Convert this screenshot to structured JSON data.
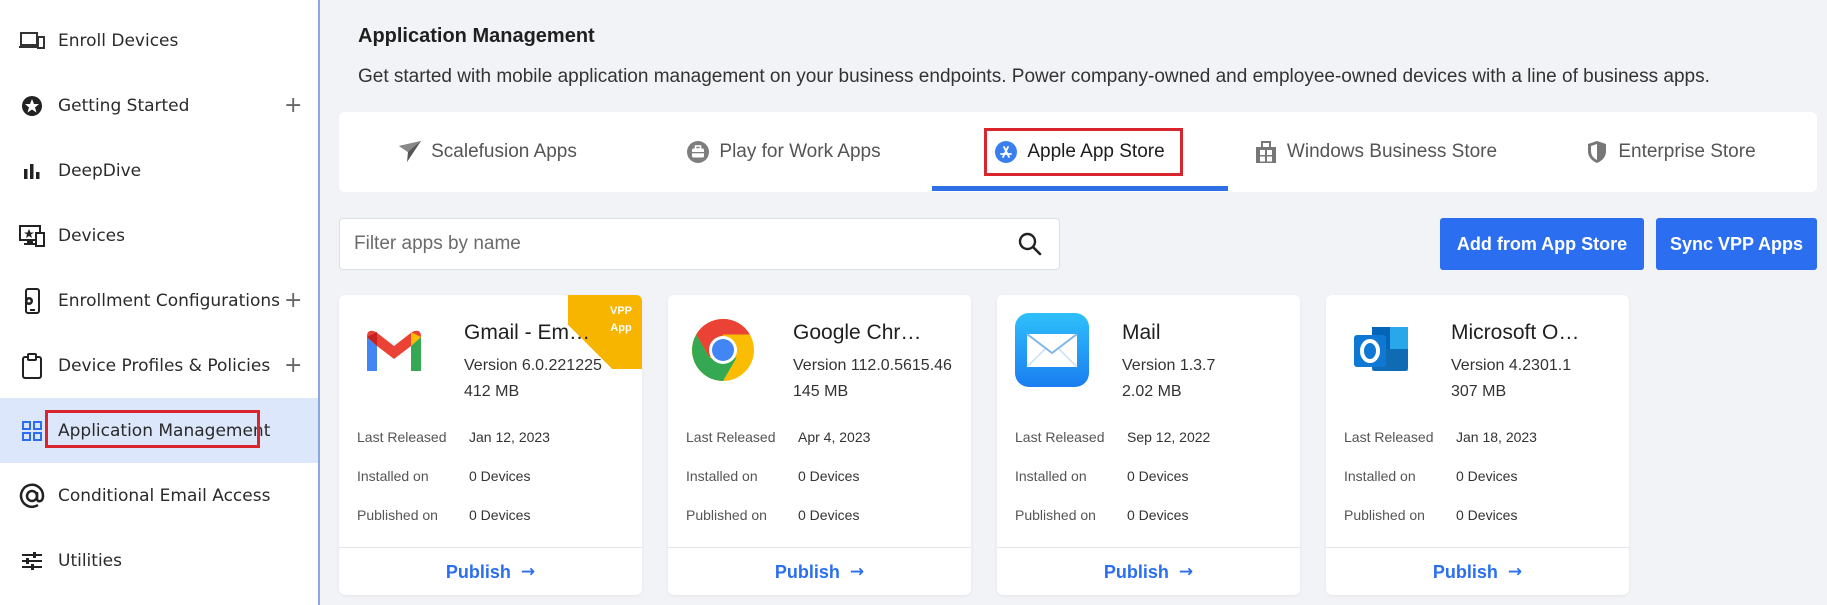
{
  "sidebar": {
    "items": [
      {
        "label": "Enroll Devices",
        "icon": "devices-icon",
        "has_plus": false
      },
      {
        "label": "Getting Started",
        "icon": "star-icon",
        "has_plus": true
      },
      {
        "label": "DeepDive",
        "icon": "bar-chart-icon",
        "has_plus": false
      },
      {
        "label": "Devices",
        "icon": "monitor-icon",
        "has_plus": false
      },
      {
        "label": "Enrollment Configurations",
        "icon": "phone-settings-icon",
        "has_plus": true
      },
      {
        "label": "Device Profiles & Policies",
        "icon": "clipboard-icon",
        "has_plus": true
      },
      {
        "label": "Application Management",
        "icon": "grid-icon",
        "has_plus": false,
        "active": true
      },
      {
        "label": "Conditional Email Access",
        "icon": "at-icon",
        "has_plus": false
      },
      {
        "label": "Utilities",
        "icon": "sliders-icon",
        "has_plus": false
      }
    ],
    "plus": "+",
    "active_color": "#dde7fb"
  },
  "header": {
    "title": "Application Management",
    "description": "Get started with mobile application management on your business endpoints. Power company-owned and employee-owned devices with a line of business apps."
  },
  "tabs": [
    {
      "label": "Scalefusion Apps",
      "icon": "scalefusion-icon"
    },
    {
      "label": "Play for Work Apps",
      "icon": "briefcase-icon"
    },
    {
      "label": "Apple App Store",
      "icon": "app-store-icon",
      "active": true
    },
    {
      "label": "Windows Business Store",
      "icon": "store-icon"
    },
    {
      "label": "Enterprise Store",
      "icon": "shield-icon"
    }
  ],
  "filter": {
    "placeholder": "Filter apps by name"
  },
  "buttons": {
    "add": "Add from App Store",
    "sync": "Sync VPP Apps"
  },
  "labels": {
    "last_released": "Last Released",
    "installed_on": "Installed on",
    "published_on": "Published on",
    "publish": "Publish",
    "arrow": "→"
  },
  "vpp": {
    "line1": "VPP",
    "line2": "App"
  },
  "apps": [
    {
      "name": "Gmail - Em…",
      "version": "Version 6.0.221225",
      "size": "412 MB",
      "last_released": "Jan 12, 2023",
      "installed": "0 Devices",
      "published": "0 Devices",
      "logo": "gmail-icon",
      "vpp": true
    },
    {
      "name": "Google Chr…",
      "version": "Version 112.0.5615.46",
      "size": "145 MB",
      "last_released": "Apr 4, 2023",
      "installed": "0 Devices",
      "published": "0 Devices",
      "logo": "chrome-icon",
      "vpp": false
    },
    {
      "name": "Mail",
      "version": "Version 1.3.7",
      "size": "2.02 MB",
      "last_released": "Sep 12, 2022",
      "installed": "0 Devices",
      "published": "0 Devices",
      "logo": "mail-icon",
      "vpp": false
    },
    {
      "name": "Microsoft O…",
      "version": "Version 4.2301.1",
      "size": "307 MB",
      "last_released": "Jan 18, 2023",
      "installed": "0 Devices",
      "published": "0 Devices",
      "logo": "outlook-icon",
      "vpp": false
    }
  ],
  "colors": {
    "accent": "#2b6ef0",
    "highlight": "#d9262e",
    "vpp": "#f7b500"
  }
}
